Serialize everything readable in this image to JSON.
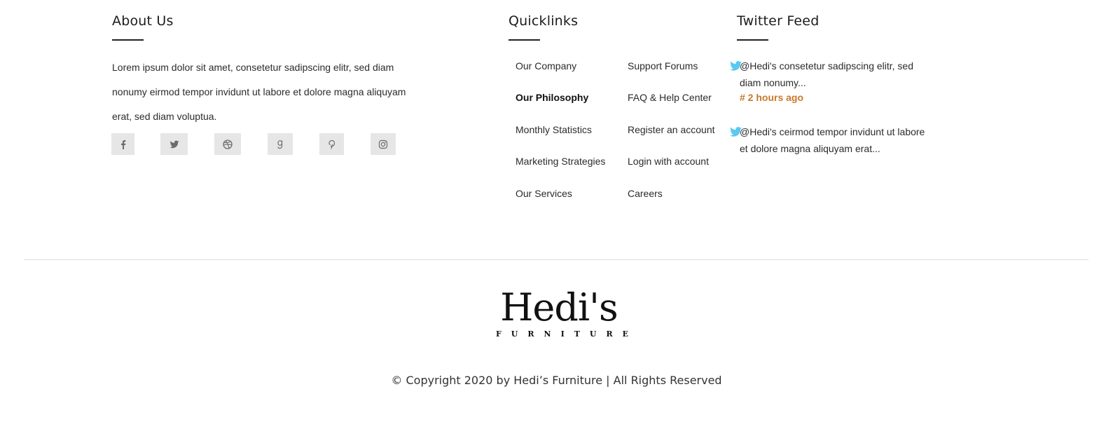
{
  "about": {
    "title": "About Us",
    "text": "Lorem ipsum dolor sit amet, consetetur sadipscing elitr, sed diam nonumy eirmod tempor invidunt ut labore et dolore magna aliquyam erat, sed diam voluptua.",
    "social_icons": [
      "facebook-icon",
      "twitter-icon",
      "dribbble-icon",
      "goodreads-icon",
      "pinterest-icon",
      "instagram-icon"
    ]
  },
  "quicklinks": {
    "title": "Quicklinks",
    "col1": [
      "Our Company",
      "Our Philosophy",
      "Monthly Statistics",
      "Marketing Strategies",
      "Our Services"
    ],
    "col2": [
      "Support Forums",
      "FAQ & Help Center",
      "Register an account",
      "Login with account",
      "Careers"
    ],
    "active": "Our Philosophy"
  },
  "twitter": {
    "title": "Twitter Feed",
    "tweets": [
      {
        "text": "@Hedi's consetetur sadipscing elitr, sed diam nonumy...",
        "time": "# 2 hours ago"
      },
      {
        "text": "@Hedi's ceirmod tempor invidunt ut labore et dolore magna aliquyam erat..."
      }
    ],
    "icon_color": "#5bc8f0",
    "time_color": "#c8782a"
  },
  "logo": {
    "name": "Hedi's",
    "tagline": "FURNITURE"
  },
  "copyright": "© Copyright 2020 by Hedi’s Furniture | All Rights Reserved"
}
